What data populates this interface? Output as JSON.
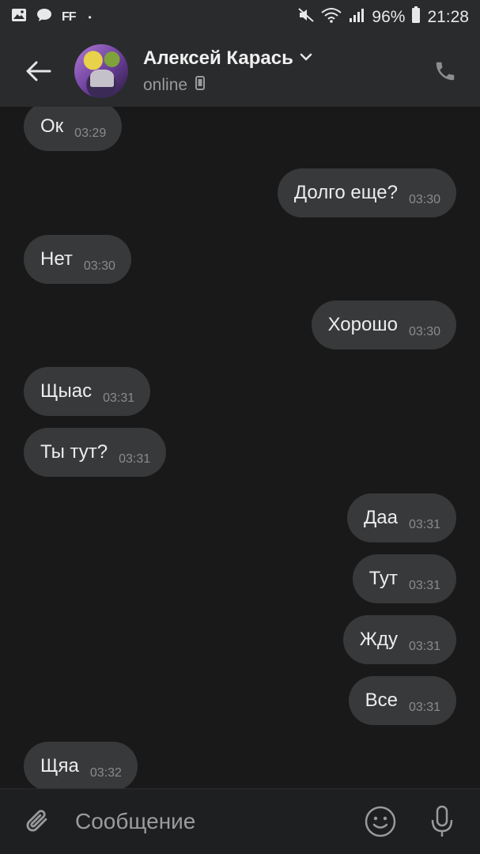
{
  "statusbar": {
    "left_icons": [
      "image-icon",
      "chat-icon",
      "ff-icon",
      "dot-icon"
    ],
    "ff_label": "FF",
    "battery": "96%",
    "time": "21:28"
  },
  "header": {
    "contact_name": "Алексей Карась",
    "status": "online"
  },
  "messages": [
    {
      "text": "Ок",
      "time": "03:29",
      "side": "in"
    },
    {
      "text": "Долго еще?",
      "time": "03:30",
      "side": "out"
    },
    {
      "text": "Нет",
      "time": "03:30",
      "side": "in"
    },
    {
      "text": "Хорошо",
      "time": "03:30",
      "side": "out"
    },
    {
      "text": "Щыас",
      "time": "03:31",
      "side": "in"
    },
    {
      "text": "Ты тут?",
      "time": "03:31",
      "side": "in"
    },
    {
      "text": "Даа",
      "time": "03:31",
      "side": "out"
    },
    {
      "text": "Тут",
      "time": "03:31",
      "side": "out"
    },
    {
      "text": "Жду",
      "time": "03:31",
      "side": "out"
    },
    {
      "text": "Все",
      "time": "03:31",
      "side": "out"
    },
    {
      "text": "Щяа",
      "time": "03:32",
      "side": "in"
    }
  ],
  "composer": {
    "placeholder": "Сообщение"
  }
}
